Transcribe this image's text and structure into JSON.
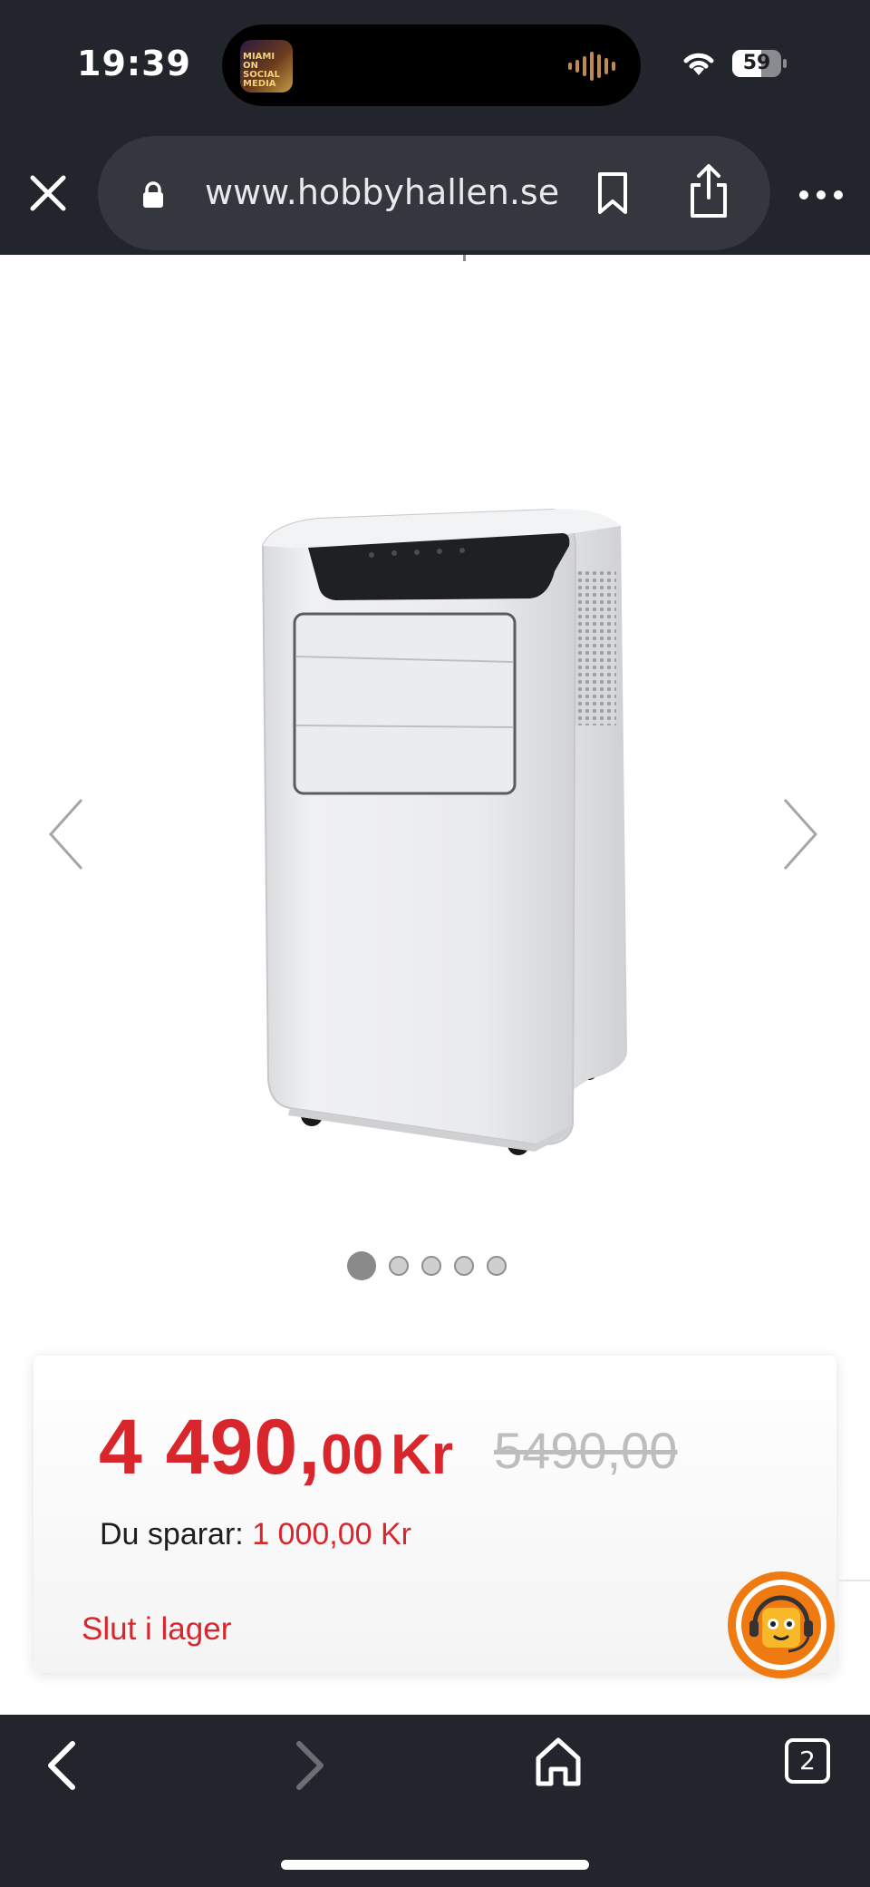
{
  "status_bar": {
    "time": "19:39",
    "battery": "59",
    "battery_level": 0.59
  },
  "now_playing": {
    "art_text": "MIAMI ON SOCIAL MEDIA",
    "icon": "audio-wave-icon",
    "color": "#c0894d"
  },
  "browser": {
    "url": "www.hobbyhallen.se",
    "tab_count": "2"
  },
  "carousel": {
    "slide_count": 5,
    "active_index": 0,
    "image": "portable-air-conditioner-white"
  },
  "product": {
    "price_integer": "4 490,",
    "price_decimals": "00",
    "currency": "Kr",
    "old_price": "5490,00",
    "save_label": "Du sparar:",
    "save_amount": "1 000,00 Kr",
    "stock_status": "Slut i lager"
  },
  "colors": {
    "accent_red": "#d9262c",
    "chrome_bg": "#22252b",
    "chat_orange": "#f07a12"
  }
}
